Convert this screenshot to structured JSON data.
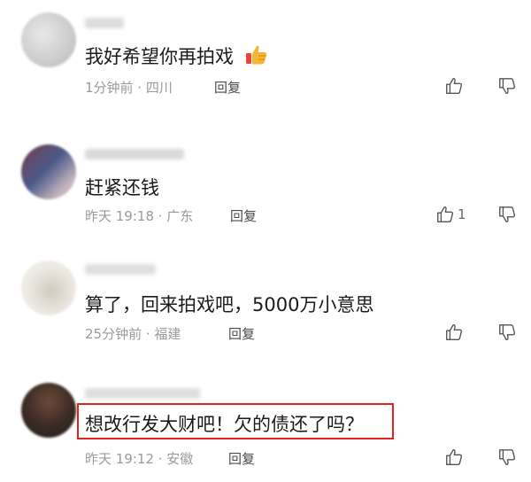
{
  "comments": [
    {
      "text": "我好希望你再拍戏",
      "emoji": "thumbs-up-emoji",
      "meta": "1分钟前 · 四川",
      "reply": "回复",
      "like_count": "",
      "avatar_colors": [
        "#cfcfcf",
        "#e6e6e6",
        "#bdbdbd"
      ]
    },
    {
      "text": "赶紧还钱",
      "meta": "昨天 19:18 · 广东",
      "reply": "回复",
      "like_count": "1",
      "avatar_colors": [
        "#7a3b4a",
        "#3b5a8a",
        "#b5a0a8"
      ]
    },
    {
      "text": "算了，回来拍戏吧，5000万小意思",
      "meta": "25分钟前 · 福建",
      "reply": "回复",
      "like_count": "",
      "avatar_colors": [
        "#e9e4dc",
        "#d6cfc4",
        "#f2eee8"
      ]
    },
    {
      "text": "想改行发大财吧！欠的债还了吗？",
      "meta": "昨天 19:12 · 安徽",
      "reply": "回复",
      "like_count": "",
      "avatar_colors": [
        "#3a2a22",
        "#6b4a3a",
        "#2a2a2a"
      ]
    }
  ],
  "icons": {
    "like": "thumbs-up-outline-icon",
    "dislike": "thumbs-down-outline-icon"
  },
  "colors": {
    "highlight_border": "#e1251b",
    "meta_text": "#9a9a9a"
  }
}
